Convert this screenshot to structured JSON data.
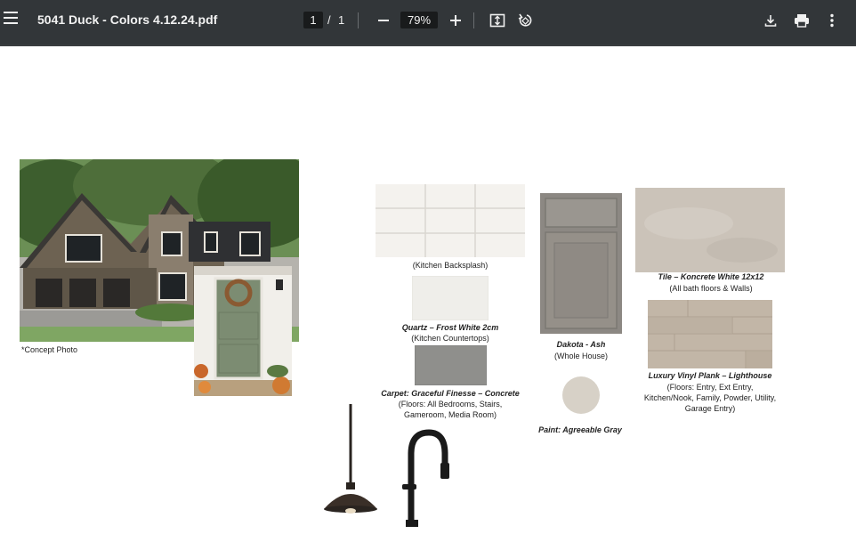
{
  "toolbar": {
    "title": "5041 Duck - Colors 4.12.24.pdf",
    "page_current": "1",
    "page_separator": "/",
    "page_total": "1",
    "zoom": "79%"
  },
  "document": {
    "concept_caption": "*Concept Photo",
    "backsplash_caption": "(Kitchen Backsplash)",
    "quartz_title": "Quartz – Frost White 2cm",
    "quartz_caption": "(Kitchen Countertops)",
    "carpet_title": "Carpet: Graceful Finesse – Concrete",
    "carpet_caption_1": "(Floors: All Bedrooms, Stairs,",
    "carpet_caption_2": "Gameroom, Media Room)",
    "cabinet_title": "Dakota - Ash",
    "cabinet_caption": "(Whole House)",
    "paint_title": "Paint: Agreeable Gray",
    "tile_title": "Tile – Koncrete White 12x12",
    "tile_caption": "(All bath floors & Walls)",
    "lvp_title": "Luxury Vinyl Plank – Lighthouse",
    "lvp_caption_1": "(Floors: Entry, Ext Entry,",
    "lvp_caption_2": "Kitchen/Nook, Family, Powder, Utility,",
    "lvp_caption_3": "Garage Entry)"
  },
  "colors": {
    "toolbar_bg": "#323639",
    "paint_swatch": "#d7d1c7",
    "door_green": "#7c8c72",
    "siding": "#6d6252"
  }
}
